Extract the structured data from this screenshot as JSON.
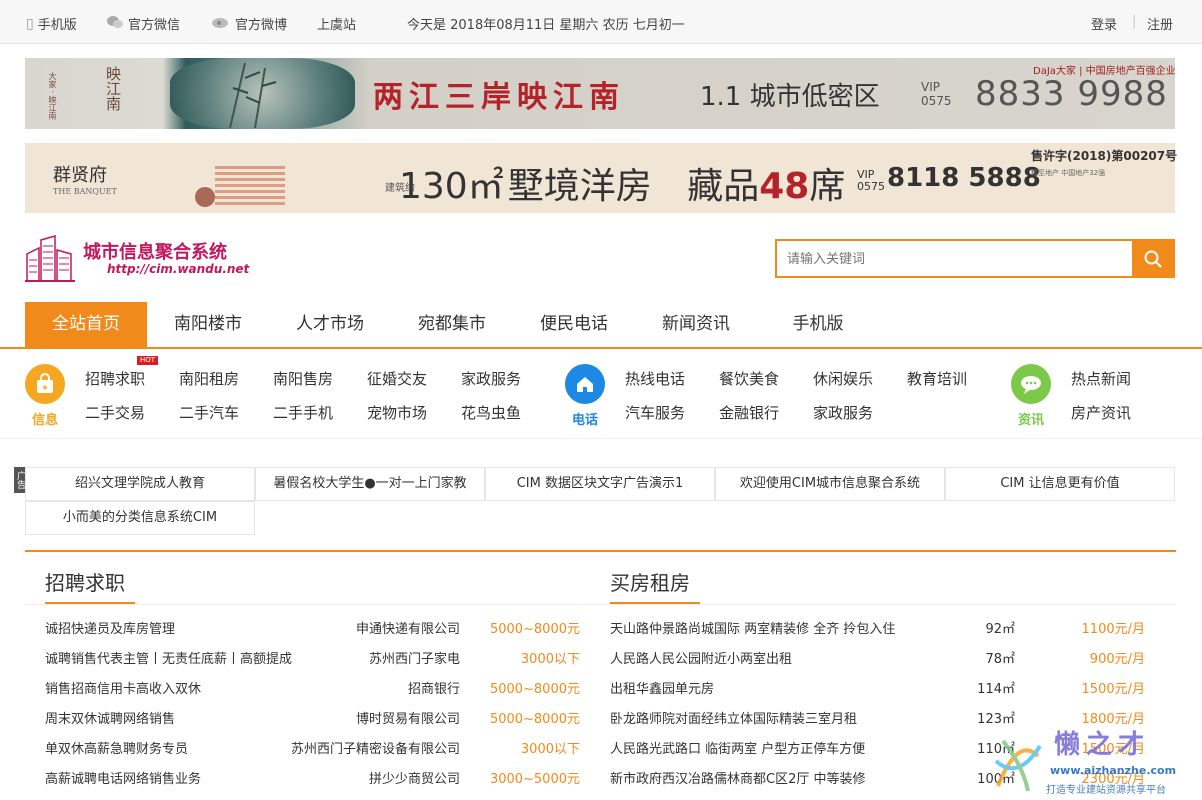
{
  "topbar": {
    "mobile": "手机版",
    "wechat": "官方微信",
    "weibo": "官方微博",
    "site": "上虞站",
    "date": "今天是 2018年08月11日 星期六 农历 七月初一",
    "login": "登录",
    "register": "注册"
  },
  "banner1": {
    "logo_text": "映江南",
    "logo_sub": "大家 · 映江南",
    "headline": "两江三岸映江南",
    "tagline": "1.1 城市低密区",
    "vip": "VIP 0575",
    "phone": "8833 9988",
    "brand": "DaJa大家 | 中国房地产百强企业"
  },
  "banner2": {
    "logo_text": "群贤府",
    "logo_sub": "THE BANQUET",
    "size_prefix": "建筑约",
    "size": "130㎡",
    "size_title": "墅境洋房",
    "pieces_prefix": "藏品",
    "pieces_num": "48",
    "pieces_suffix": "席",
    "vip": "VIP 0575",
    "phone": "8118 5888",
    "permit": "售许字(2018)第00207号",
    "fine": "精至地产 中国地产32强"
  },
  "site": {
    "name": "城市信息聚合系统",
    "url": "http://cim.wandu.net"
  },
  "search": {
    "placeholder": "请输入关键词"
  },
  "nav": {
    "tabs": [
      "全站首页",
      "南阳楼市",
      "人才市场",
      "宛都集市",
      "便民电话",
      "新闻资讯",
      "手机版"
    ]
  },
  "categories": {
    "info": {
      "label": "信息",
      "links": [
        "招聘求职",
        "南阳租房",
        "南阳售房",
        "征婚交友",
        "家政服务",
        "二手交易",
        "二手汽车",
        "二手手机",
        "宠物市场",
        "花鸟虫鱼"
      ],
      "hot_badge": "HOT"
    },
    "phone": {
      "label": "电话",
      "links": [
        "热线电话",
        "餐饮美食",
        "休闲娱乐",
        "教育培训",
        "汽车服务",
        "金融银行",
        "家政服务"
      ]
    },
    "news": {
      "label": "资讯",
      "links": [
        "热点新闻",
        "房产资讯"
      ]
    }
  },
  "ad": {
    "tag": "广告",
    "items": [
      "绍兴文理学院成人教育",
      "暑假名校大学生●一对一上门家教",
      "CIM 数据区块文字广告演示1",
      "欢迎使用CIM城市信息聚合系统",
      "CIM 让信息更有价值",
      "小而美的分类信息系统CIM"
    ]
  },
  "jobs": {
    "title": "招聘求职",
    "rows": [
      {
        "title": "诚招快递员及库房管理",
        "company": "申通快递有限公司",
        "salary": "5000~8000元"
      },
      {
        "title": "诚聘销售代表主管丨无责任底薪丨高额提成",
        "company": "苏州西门子家电",
        "salary": "3000以下"
      },
      {
        "title": "销售招商信用卡高收入双休",
        "company": "招商银行",
        "salary": "5000~8000元"
      },
      {
        "title": "周末双休诚聘网络销售",
        "company": "博时贸易有限公司",
        "salary": "5000~8000元"
      },
      {
        "title": "单双休高薪急聘财务专员",
        "company": "苏州西门子精密设备有限公司",
        "salary": "3000以下"
      },
      {
        "title": "高薪诚聘电话网络销售业务",
        "company": "拼少少商贸公司",
        "salary": "3000~5000元"
      }
    ]
  },
  "housing": {
    "title": "买房租房",
    "rows": [
      {
        "title": "天山路仲景路尚城国际 两室精装修 全齐 拎包入住",
        "area": "92㎡",
        "price": "1100元/月"
      },
      {
        "title": "人民路人民公园附近小两室出租",
        "area": "78㎡",
        "price": "900元/月"
      },
      {
        "title": "出租华鑫园单元房",
        "area": "114㎡",
        "price": "1500元/月"
      },
      {
        "title": "卧龙路师院对面经纬立体国际精装三室月租",
        "area": "123㎡",
        "price": "1800元/月"
      },
      {
        "title": "人民路光武路口 临街两室 户型方正停车方便",
        "area": "110㎡",
        "price": "1500元/月"
      },
      {
        "title": "新市政府西汉冶路儒林商都C区2厅 中等装修",
        "area": "100㎡",
        "price": "2300元/月"
      }
    ]
  },
  "watermark": {
    "name": "懒之才",
    "url": "www.aizhanzhe.com",
    "slogan": "打造专业建站资源共享平台"
  },
  "colors": {
    "accent": "#f08a1a",
    "brand": "#c2185b",
    "headline_red": "#b5232a"
  }
}
